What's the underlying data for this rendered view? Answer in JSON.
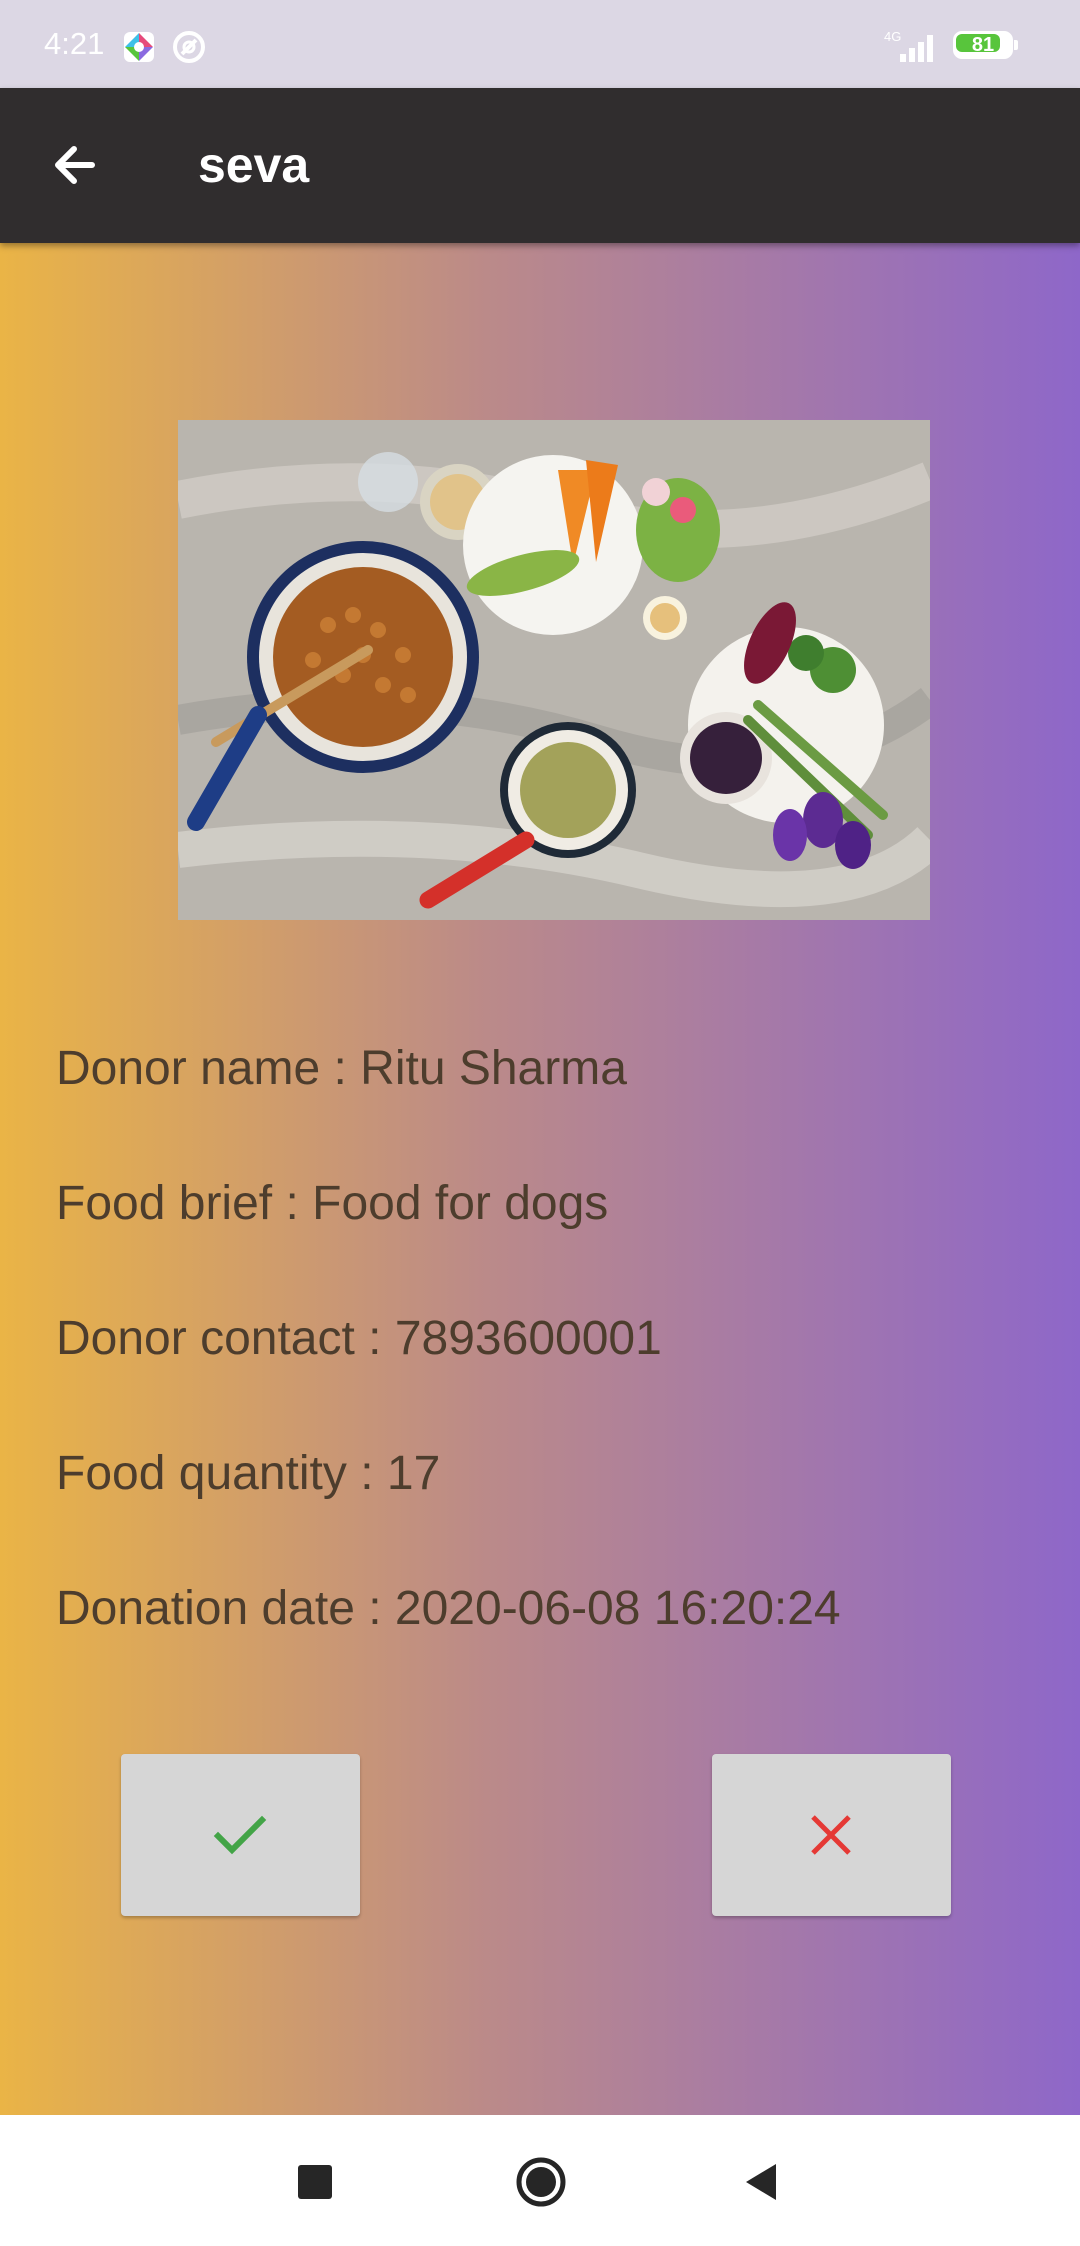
{
  "status_bar": {
    "time": "4:21",
    "network": "4G",
    "battery_percent": "81",
    "battery_level": 0.81,
    "icons": [
      "app-notification-icon",
      "sync-icon",
      "signal-icon",
      "battery-icon"
    ]
  },
  "toolbar": {
    "title": "seva",
    "back_icon": "arrow-left-icon"
  },
  "details": {
    "donor_name": "Donor name : Ritu Sharma",
    "food_brief": "Food brief : Food for dogs",
    "donor_contact": "Donor contact : 7893600001",
    "food_quantity": "Food quantity : 17",
    "donation_date": "Donation date : 2020-06-08 16:20:24"
  },
  "actions": {
    "accept_icon": "checkmark-icon",
    "reject_icon": "close-icon"
  },
  "navigation": {
    "icons": [
      "recents-square-icon",
      "home-circle-icon",
      "back-triangle-icon"
    ]
  },
  "colors": {
    "gradient_start": "#eab446",
    "gradient_end": "#8e67c9",
    "toolbar": "#302d2e",
    "accept": "#43a447",
    "reject": "#e53935",
    "text": "#4d3d2d"
  }
}
